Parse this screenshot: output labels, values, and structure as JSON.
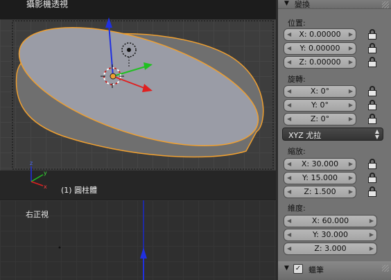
{
  "viewport_top": {
    "title": "攝影機透視",
    "object_label": "(1) 圓柱體"
  },
  "viewport_bottom": {
    "title": "右正視"
  },
  "panel": {
    "transform_header": "變換",
    "location": {
      "label": "位置:",
      "x": "X: 0.00000",
      "y": "Y: 0.00000",
      "z": "Z: 0.00000"
    },
    "rotation": {
      "label": "旋轉:",
      "x": "X: 0°",
      "y": "Y: 0°",
      "z": "Z: 0°"
    },
    "rotation_mode": "XYZ 尤拉",
    "scale": {
      "label": "縮放:",
      "x": "X: 30.000",
      "y": "Y: 15.000",
      "z": "Z: 1.500"
    },
    "dimensions": {
      "label": "維度:",
      "x": "X: 60.000",
      "y": "Y: 30.000",
      "z": "Z: 3.000"
    },
    "grease_pencil_header": "蠟筆"
  },
  "colors": {
    "x_axis": "#e02020",
    "y_axis": "#20c020",
    "z_axis": "#2030e0",
    "selection_outline": "#f0a030"
  }
}
